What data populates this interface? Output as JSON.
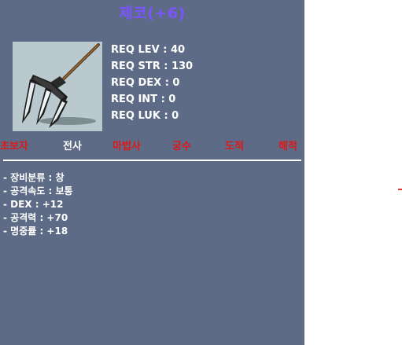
{
  "item": {
    "name": "제코(+6)",
    "icon": "jeko-spear-icon",
    "name_color": "#7a55ff"
  },
  "requirements": [
    "REQ LEV : 40",
    "REQ STR : 130",
    "REQ DEX : 0",
    "REQ INT : 0",
    "REQ LUK : 0"
  ],
  "jobs": [
    {
      "label": "초보자",
      "color": "#e01818"
    },
    {
      "label": "전사",
      "color": "#ffffff"
    },
    {
      "label": "마법사",
      "color": "#e01818"
    },
    {
      "label": "궁수",
      "color": "#e01818"
    },
    {
      "label": "도적",
      "color": "#e01818"
    },
    {
      "label": "해적",
      "color": "#e01818"
    }
  ],
  "stats": [
    "- 장비분류 : 창",
    "- 공격속도 : 보통",
    "- DEX : +12",
    "- 공격력 : +70",
    "- 명중률 : +18"
  ],
  "colors": {
    "panel_bg": "#5e6b86",
    "icon_bg": "#b9c9cd"
  }
}
